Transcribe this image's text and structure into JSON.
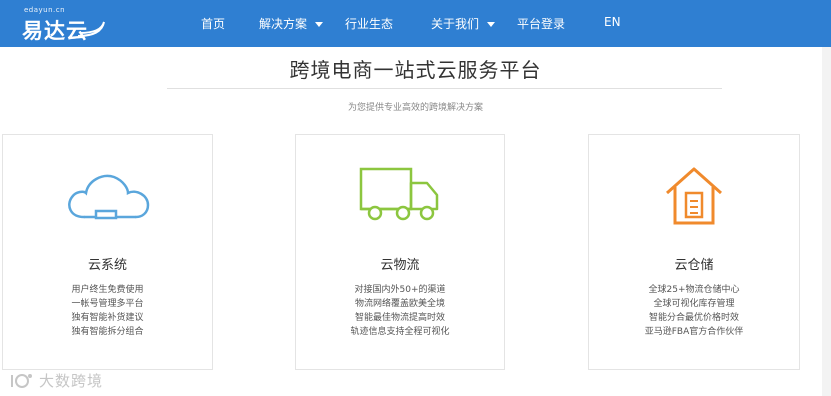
{
  "header": {
    "logo": {
      "domain": "edayun.cn",
      "name": "易达云"
    },
    "nav": [
      {
        "label": "首页",
        "has_dropdown": false
      },
      {
        "label": "解决方案",
        "has_dropdown": true
      },
      {
        "label": "行业生态",
        "has_dropdown": false
      },
      {
        "label": "关于我们",
        "has_dropdown": true
      },
      {
        "label": "平台登录",
        "has_dropdown": false
      },
      {
        "label": "EN",
        "has_dropdown": false
      }
    ],
    "colors": {
      "bar": "#2f7fd2",
      "text": "#ffffff"
    }
  },
  "main": {
    "title": "跨境电商一站式云服务平台",
    "subtitle": "为您提供专业高效的跨境解决方案",
    "cards": [
      {
        "icon": "cloud-icon",
        "icon_color": "#5aa6dc",
        "title": "云系统",
        "lines": [
          "用户终生免费使用",
          "一帐号管理多平台",
          "独有智能补货建议",
          "独有智能拆分组合"
        ]
      },
      {
        "icon": "truck-icon",
        "icon_color": "#8cc63f",
        "title": "云物流",
        "lines": [
          "对接国内外50+的渠道",
          "物流网络覆盖欧美全境",
          "智能最佳物流提高时效",
          "轨迹信息支持全程可视化"
        ]
      },
      {
        "icon": "warehouse-icon",
        "icon_color": "#f08a2c",
        "title": "云仓储",
        "lines": [
          "全球25+物流仓储中心",
          "全球可视化库存管理",
          "智能分合最优价格时效",
          "亚马逊FBA官方合作伙伴"
        ]
      }
    ]
  },
  "watermark": {
    "text": "大数跨境"
  }
}
